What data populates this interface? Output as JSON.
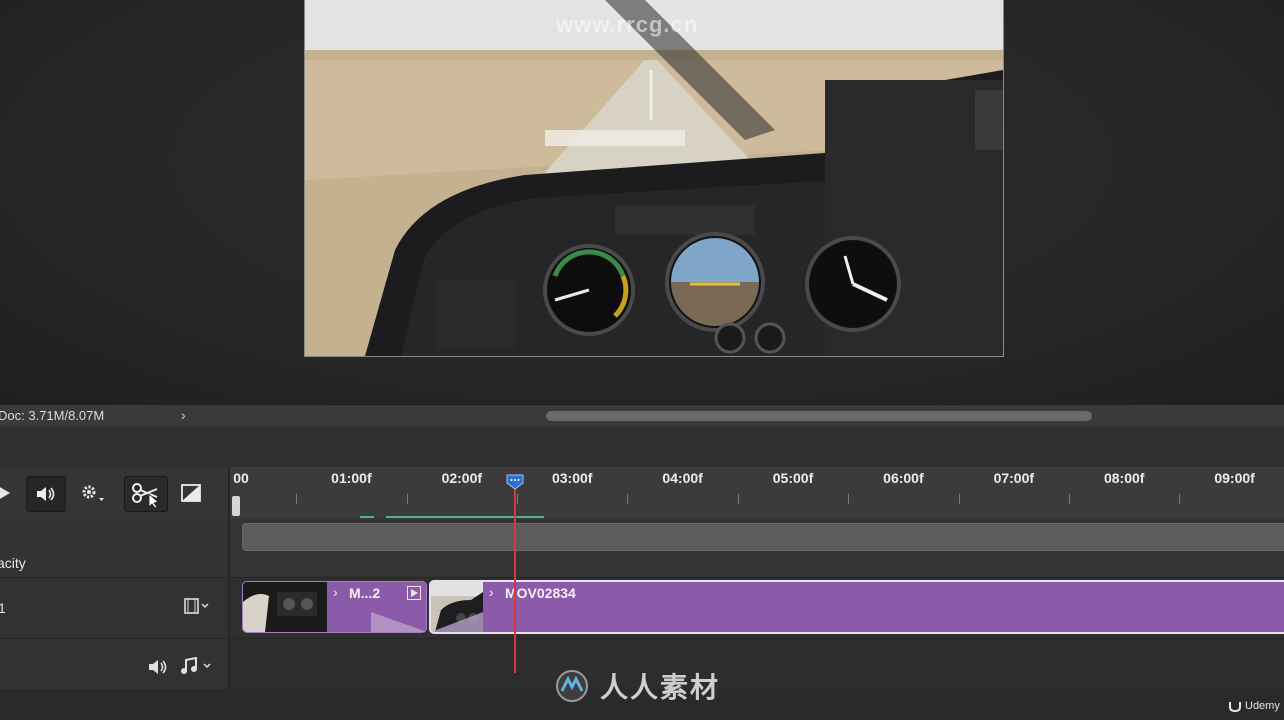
{
  "canvas": {
    "watermark": "www.rrcg.cn"
  },
  "status_bar": {
    "doc_size": "Doc: 3.71M/8.07M",
    "expand_glyph": "›"
  },
  "transport": {
    "play_icon": "play-icon",
    "audio_icon": "speaker-icon",
    "settings_icon": "gear-icon",
    "split_icon": "scissors-icon",
    "transition_icon": "transition-icon"
  },
  "ruler": {
    "labels": [
      "00",
      "01:00f",
      "02:00f",
      "03:00f",
      "04:00f",
      "05:00f",
      "06:00f",
      "07:00f",
      "08:00f",
      "09:00f"
    ],
    "current_time_frames": 2.4
  },
  "layers": {
    "opacity_label": "acity",
    "video_layer_name": "1",
    "video_menu_icon": "film-icon",
    "audio_menu_icon": "music-note-icon",
    "audio_mute_icon": "speaker-icon"
  },
  "clips": [
    {
      "name": "M...2",
      "chevron": "›"
    },
    {
      "name": "MOV02834",
      "chevron": "›"
    }
  ],
  "watermark_bottom": {
    "text": "人人素材"
  },
  "udemy": {
    "text": "Udemy"
  },
  "colors": {
    "clip_purple": "#8b5aa8",
    "playhead_red": "#d23a3a",
    "playhead_handle_blue": "#2f6fd0",
    "cache_teal": "#4fb0a0"
  }
}
